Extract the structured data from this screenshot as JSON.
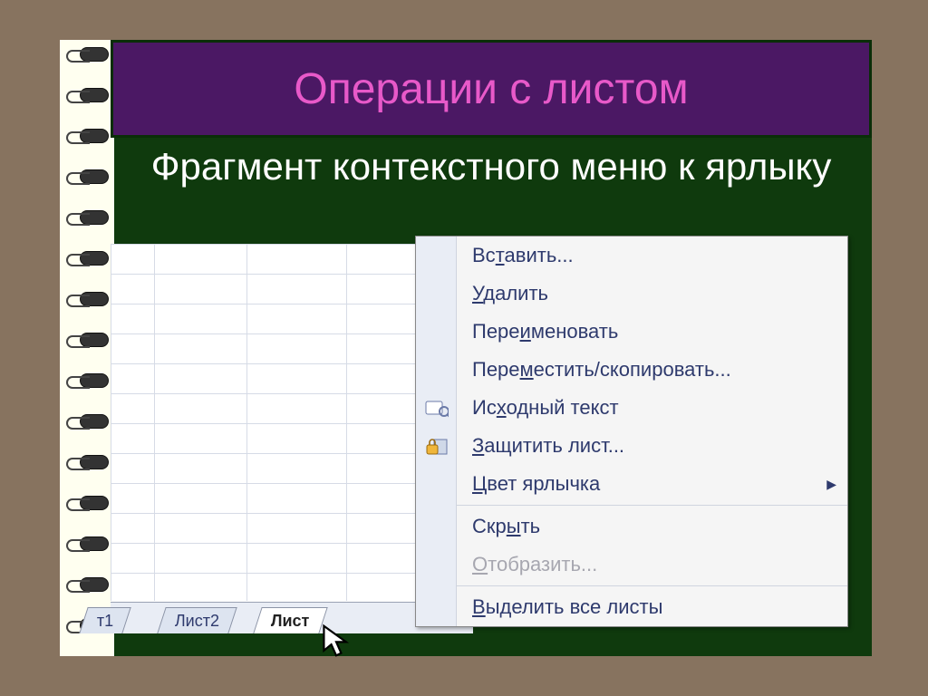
{
  "title": "Операции с листом",
  "subtitle": "Фрагмент контекстного меню к ярлыку",
  "sheet_tabs": {
    "t1": "т1",
    "t2": "Лист2",
    "t3": "Лист"
  },
  "context_menu": {
    "insert": {
      "pre": "Вс",
      "u": "т",
      "post": "авить..."
    },
    "delete": {
      "pre": "",
      "u": "У",
      "post": "далить"
    },
    "rename": {
      "pre": "Пере",
      "u": "и",
      "post": "меновать"
    },
    "move": {
      "pre": "Пере",
      "u": "м",
      "post": "естить/скопировать..."
    },
    "source": {
      "pre": "Ис",
      "u": "х",
      "post": "одный текст"
    },
    "protect": {
      "pre": "",
      "u": "З",
      "post": "ащитить лист..."
    },
    "tabcolor": {
      "pre": "",
      "u": "Ц",
      "post": "вет ярлычка"
    },
    "hide": {
      "pre": "Скр",
      "u": "ы",
      "post": "ть"
    },
    "unhide": {
      "pre": "",
      "u": "О",
      "post": "тобразить..."
    },
    "selectall": {
      "pre": "",
      "u": "В",
      "post": "ыделить все листы"
    }
  }
}
